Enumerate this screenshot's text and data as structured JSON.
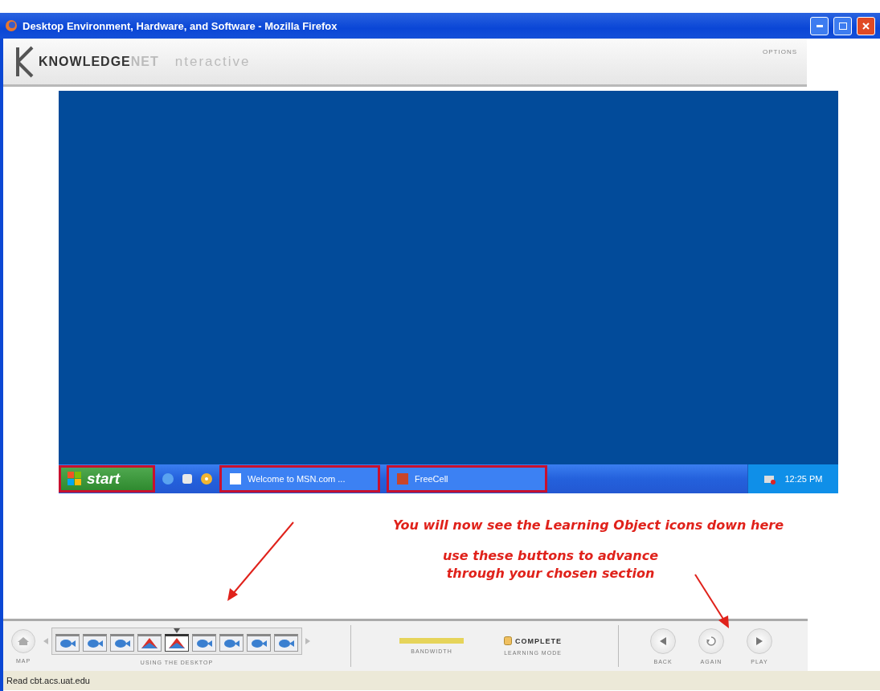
{
  "window": {
    "title": "Desktop Environment, Hardware, and Software - Mozilla Firefox"
  },
  "header": {
    "brand_main": "KNOWLEDGE",
    "brand_accent": "NET",
    "brand_suffix": "nteractive",
    "options": "OPTIONS"
  },
  "taskbar": {
    "start": {
      "label": "start",
      "highlighted": true
    },
    "tasks": [
      {
        "label": "Welcome to MSN.com ...",
        "highlighted": true
      },
      {
        "label": "FreeCell",
        "highlighted": true
      }
    ],
    "clock": "12:25 PM"
  },
  "annotations": [
    "You will now see the Learning Object icons down here",
    "use these buttons to advance through your chosen section"
  ],
  "player": {
    "map_label": "MAP",
    "lesson_label": "USING THE DESKTOP",
    "objects": [
      {
        "kind": "video",
        "selected": false
      },
      {
        "kind": "video",
        "selected": false
      },
      {
        "kind": "video",
        "selected": false
      },
      {
        "kind": "exercise",
        "selected": false
      },
      {
        "kind": "exercise",
        "selected": true
      },
      {
        "kind": "video",
        "selected": false
      },
      {
        "kind": "video",
        "selected": false
      },
      {
        "kind": "video",
        "selected": false
      },
      {
        "kind": "video",
        "selected": false
      }
    ],
    "bandwidth": {
      "label": "BANDWIDTH",
      "level": 1
    },
    "status": "COMPLETE",
    "mode_label": "LEARNING MODE",
    "buttons": [
      {
        "kind": "back",
        "label": "BACK"
      },
      {
        "kind": "again",
        "label": "AGAIN"
      },
      {
        "kind": "play",
        "label": "PLAY"
      }
    ]
  },
  "status_bar": "Read cbt.acs.uat.edu"
}
